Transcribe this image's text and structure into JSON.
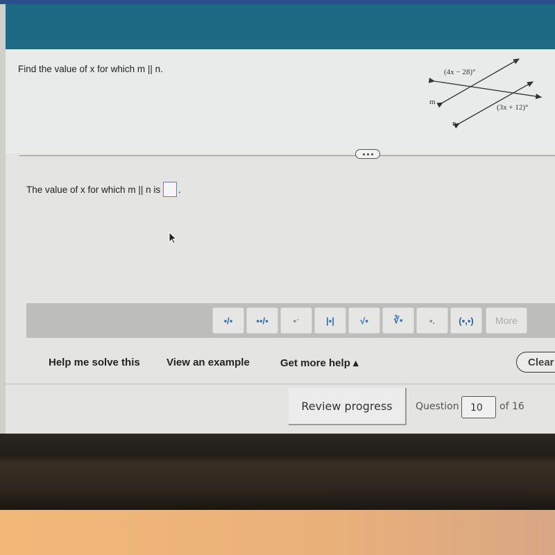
{
  "question": {
    "prompt": "Find the value of x for which m || n.",
    "diagram": {
      "angle_top": "(4x − 28)°",
      "angle_bottom": "(3x + 12)°",
      "line_m": "m",
      "line_n": "n"
    }
  },
  "answer": {
    "prefix": "The value of x for which m || n is",
    "value": "",
    "suffix": "."
  },
  "toolbar": {
    "buttons": [
      {
        "name": "fraction",
        "glyph": "▪/▪"
      },
      {
        "name": "mixed-number",
        "glyph": "▪▪/▪"
      },
      {
        "name": "exponent",
        "glyph": "▪ˑ"
      },
      {
        "name": "absolute-value",
        "glyph": "|▪|"
      },
      {
        "name": "square-root",
        "glyph": "√▪"
      },
      {
        "name": "nth-root",
        "glyph": "∛▪"
      },
      {
        "name": "subscript",
        "glyph": "▪."
      },
      {
        "name": "ordered-pair",
        "glyph": "(▪,▪)"
      }
    ],
    "more_label": "More"
  },
  "help": {
    "solve": "Help me solve this",
    "example": "View an example",
    "more_help": "Get more help ▴",
    "clear": "Clear"
  },
  "footer": {
    "review": "Review progress",
    "question_label": "Question",
    "question_number": "10",
    "of_total": "of 16"
  }
}
